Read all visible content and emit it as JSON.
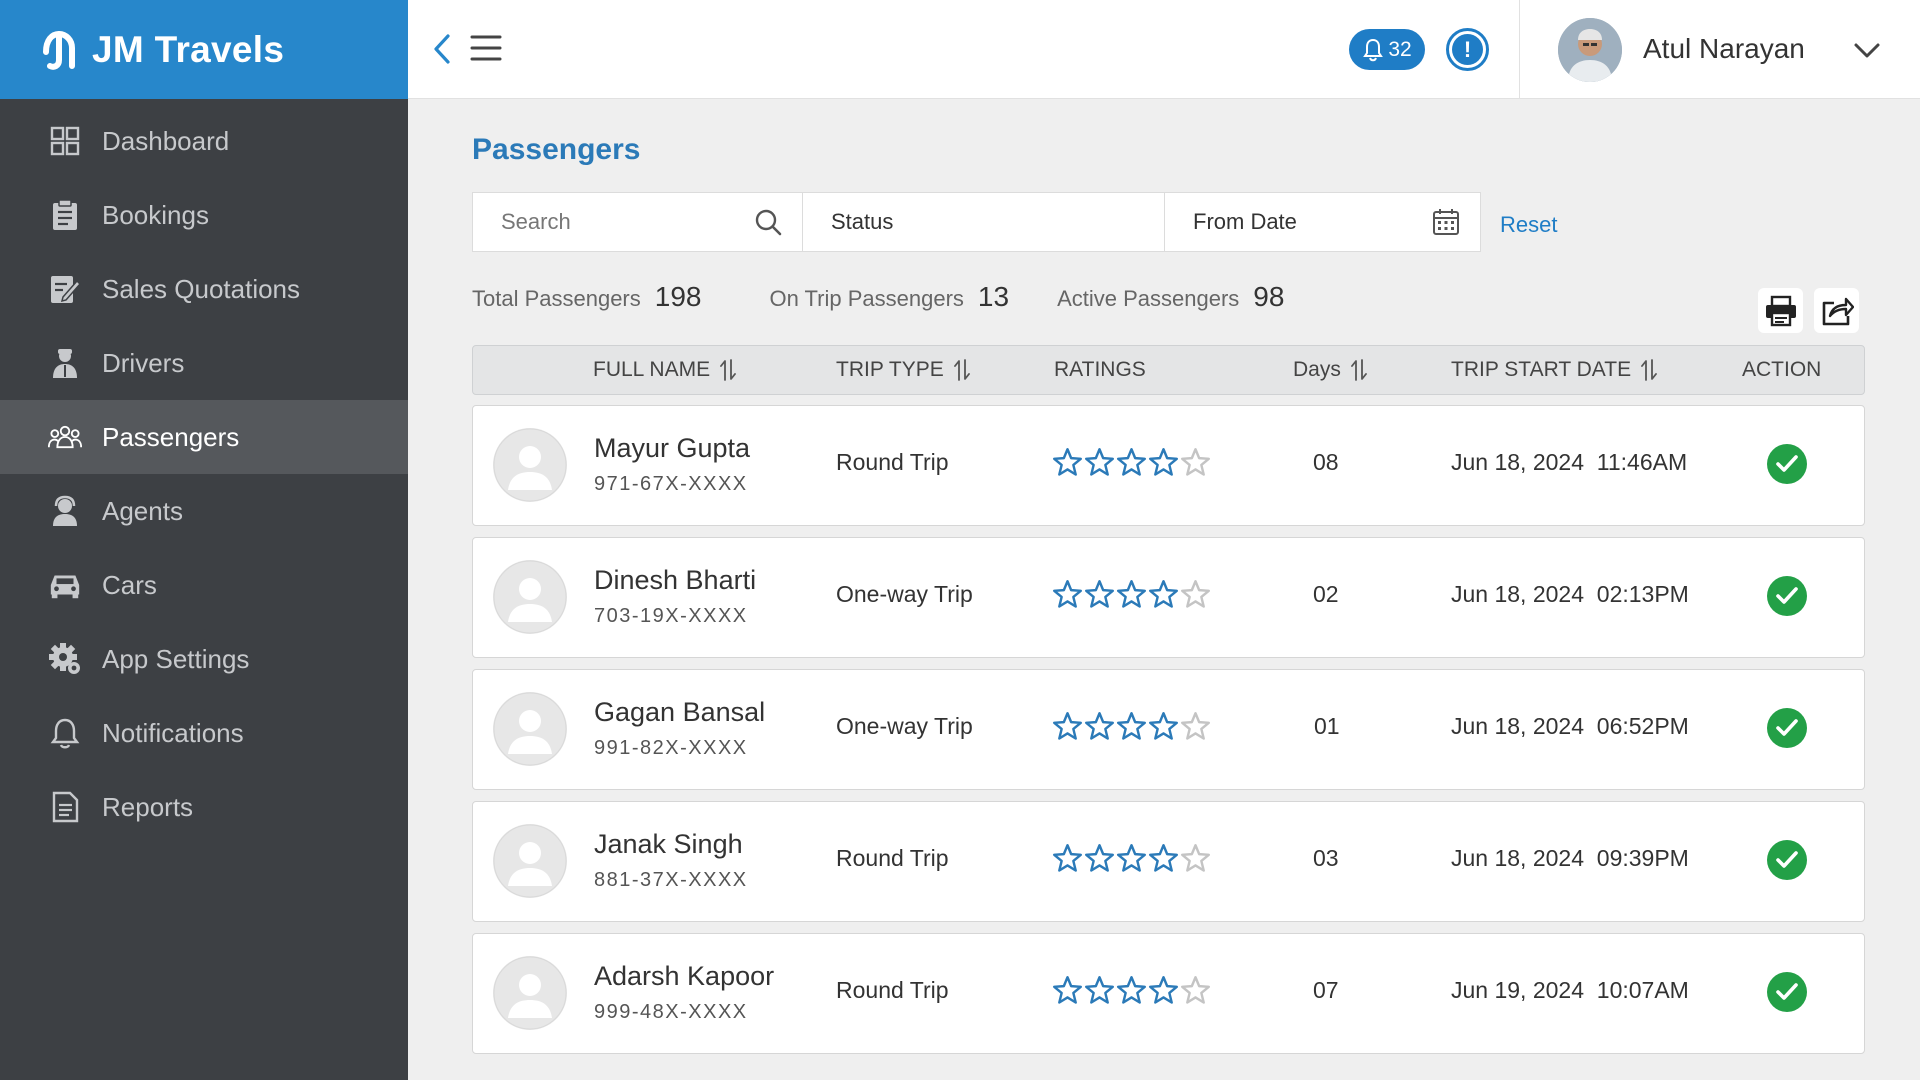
{
  "brand": {
    "name": "JM Travels"
  },
  "sidebar": {
    "items": [
      {
        "label": "Dashboard",
        "icon": "dashboard-icon"
      },
      {
        "label": "Bookings",
        "icon": "bookings-icon"
      },
      {
        "label": "Sales Quotations",
        "icon": "quotations-icon"
      },
      {
        "label": "Drivers",
        "icon": "driver-icon"
      },
      {
        "label": "Passengers",
        "icon": "passengers-icon",
        "active": true
      },
      {
        "label": "Agents",
        "icon": "agent-icon"
      },
      {
        "label": "Cars",
        "icon": "car-icon"
      },
      {
        "label": "App Settings",
        "icon": "gear-icon"
      },
      {
        "label": "Notifications",
        "icon": "bell-icon"
      },
      {
        "label": "Reports",
        "icon": "report-icon"
      }
    ]
  },
  "header": {
    "notification_count": "32",
    "alert_symbol": "!",
    "user_name": "Atul Narayan"
  },
  "main": {
    "title": "Passengers",
    "filters": {
      "search_placeholder": "Search",
      "status_label": "Status",
      "from_date_label": "From Date",
      "reset_label": "Reset"
    },
    "stats": {
      "total_label": "Total Passengers",
      "total_value": "198",
      "on_trip_label": "On Trip Passengers",
      "on_trip_value": "13",
      "active_label": "Active Passengers",
      "active_value": "98"
    },
    "table": {
      "columns": {
        "full_name": "FULL NAME",
        "trip_type": "TRIP TYPE",
        "ratings": "RATINGS",
        "days": "Days",
        "trip_start_date": "TRIP START DATE",
        "action": "ACTION"
      },
      "rows": [
        {
          "name": "Mayur Gupta",
          "phone": "971-67X-XXXX",
          "trip_type": "Round Trip",
          "rating": 4,
          "days": "08",
          "date": "Jun 18, 2024  11:46AM"
        },
        {
          "name": "Dinesh Bharti",
          "phone": "703-19X-XXXX",
          "trip_type": "One-way Trip",
          "rating": 4,
          "days": "02",
          "date": "Jun 18, 2024  02:13PM"
        },
        {
          "name": "Gagan Bansal",
          "phone": "991-82X-XXXX",
          "trip_type": "One-way Trip",
          "rating": 4,
          "days": "01",
          "date": "Jun 18, 2024  06:52PM"
        },
        {
          "name": "Janak Singh",
          "phone": "881-37X-XXXX",
          "trip_type": "Round Trip",
          "rating": 4,
          "days": "03",
          "date": "Jun 18, 2024  09:39PM"
        },
        {
          "name": "Adarsh Kapoor",
          "phone": "999-48X-XXXX",
          "trip_type": "Round Trip",
          "rating": 4,
          "days": "07",
          "date": "Jun 19, 2024  10:07AM"
        }
      ]
    }
  },
  "colors": {
    "brand_blue": "#2787cb",
    "sidebar_bg": "#3d4044",
    "sidebar_active": "#55585c",
    "accent": "#1f7dc6",
    "success": "#23a047",
    "star": "#2b7ab8"
  }
}
